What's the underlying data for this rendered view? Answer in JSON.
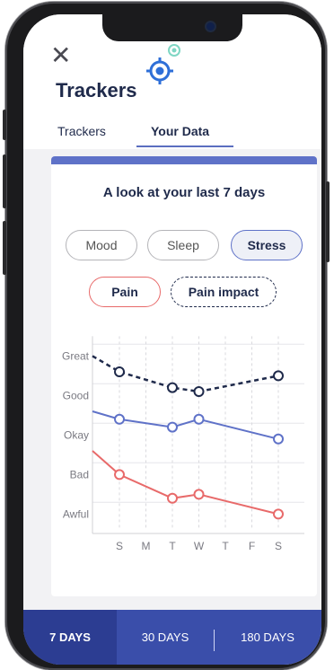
{
  "header": {
    "title": "Trackers"
  },
  "tabs": [
    {
      "label": "Trackers"
    },
    {
      "label": "Your Data"
    }
  ],
  "card": {
    "title": "A look at your last 7 days",
    "filters": [
      {
        "label": "Mood"
      },
      {
        "label": "Sleep"
      },
      {
        "label": "Stress"
      },
      {
        "label": "Pain"
      },
      {
        "label": "Pain impact"
      }
    ]
  },
  "colors": {
    "accent": "#5f72c8",
    "dark": "#1f2a4b",
    "pain": "#e86a6a"
  },
  "chart_data": {
    "type": "line",
    "y_categories": [
      "Great",
      "Good",
      "Okay",
      "Bad",
      "Awful"
    ],
    "x": [
      "S",
      "M",
      "T",
      "W",
      "T",
      "F",
      "S"
    ],
    "series": [
      {
        "name": "Pain impact",
        "style": "dashed",
        "color": "#1f2a4b",
        "values": [
          4.4,
          4.0,
          null,
          3.6,
          3.5,
          null,
          null,
          3.9
        ],
        "points": [
          [
            0,
            4.0
          ],
          [
            2,
            3.6
          ],
          [
            3,
            3.5
          ],
          [
            6,
            3.9
          ]
        ]
      },
      {
        "name": "Stress",
        "style": "solid",
        "color": "#5f72c8",
        "points": [
          [
            0,
            2.8
          ],
          [
            2,
            2.6
          ],
          [
            3,
            2.8
          ],
          [
            6,
            2.3
          ]
        ]
      },
      {
        "name": "Pain",
        "style": "solid",
        "color": "#e86a6a",
        "points": [
          [
            0,
            1.4
          ],
          [
            2,
            0.8
          ],
          [
            3,
            0.9
          ],
          [
            6,
            0.4
          ]
        ]
      }
    ],
    "start_values": {
      "Pain impact": 4.4,
      "Stress": 3.0,
      "Pain": 2.0
    }
  },
  "bottom_tabs": [
    {
      "label": "7 DAYS"
    },
    {
      "label": "30 DAYS"
    },
    {
      "label": "180 DAYS"
    }
  ]
}
